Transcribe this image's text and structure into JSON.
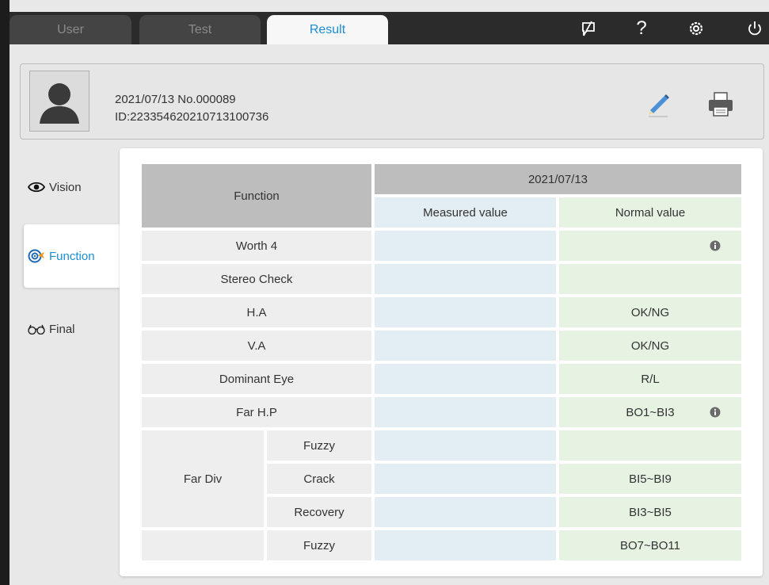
{
  "tabs": {
    "user": "User",
    "test": "Test",
    "result": "Result"
  },
  "top_icons": [
    "no-comment-icon",
    "help-icon",
    "settings-icon",
    "power-icon"
  ],
  "help_glyph": "?",
  "info": {
    "line1": "2021/07/13   No.000089",
    "line2": "ID:223354620210713100736"
  },
  "side_menu": [
    {
      "label": "Vision",
      "icon": "eye-icon"
    },
    {
      "label": "Function",
      "icon": "target-icon",
      "active": true
    },
    {
      "label": "Final",
      "icon": "glasses-icon"
    }
  ],
  "table": {
    "function_header": "Function",
    "date_header": "2021/07/13",
    "measured_header": "Measured value",
    "normal_header": "Normal value",
    "rows": {
      "worth4": {
        "label": "Worth 4",
        "normal": ""
      },
      "stereo": {
        "label": "Stereo Check",
        "normal": ""
      },
      "ha": {
        "label": "H.A",
        "normal": "OK/NG"
      },
      "va": {
        "label": "V.A",
        "normal": "OK/NG"
      },
      "dominant": {
        "label": "Dominant Eye",
        "normal": "R/L"
      },
      "farhp": {
        "label": "Far H.P",
        "normal": "BO1~BI3"
      },
      "fardiv_group": "Far Div",
      "fardiv_fuzzy": {
        "label": "Fuzzy",
        "normal": ""
      },
      "fardiv_crack": {
        "label": "Crack",
        "normal": "BI5~BI9"
      },
      "fardiv_recovery": {
        "label": "Recovery",
        "normal": "BI3~BI5"
      },
      "last_fuzzy": {
        "label": "Fuzzy",
        "normal": "BO7~BO11"
      }
    }
  },
  "colors": {
    "accent": "#1a8fd3",
    "header_gray": "#bdbdbd",
    "measured_bg": "#e2eef3",
    "normal_bg": "#e6f3e3"
  }
}
